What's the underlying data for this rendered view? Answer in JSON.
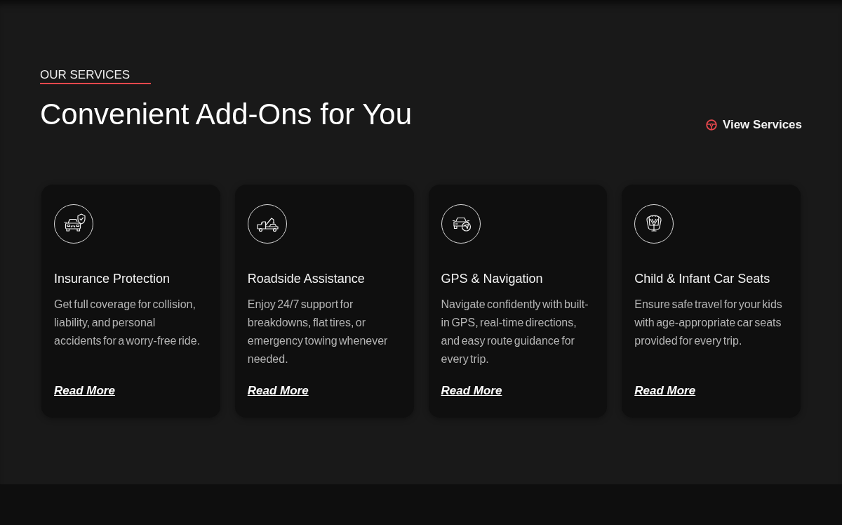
{
  "section": {
    "eyebrow": "OUR SERVICES",
    "heading": "Convenient Add-Ons for You",
    "link": {
      "label": "View Services"
    }
  },
  "cards": [
    {
      "title": "Insurance Protection",
      "description": "Get full coverage for collision, liability, and personal accidents for a worry-free ride.",
      "link": "Read More"
    },
    {
      "title": "Roadside Assistance",
      "description": "Enjoy 24/7 support for breakdowns, flat tires, or emergency towing whenever needed.",
      "link": "Read More"
    },
    {
      "title": "GPS & Navigation",
      "description": "Navigate confidently with built-in GPS, real-time directions, and easy route guidance for every trip.",
      "link": "Read More"
    },
    {
      "title": "Child & Infant Car Seats",
      "description": "Ensure safe travel for your kids with age-appropriate car seats provided for every trip.",
      "link": "Read More"
    }
  ]
}
